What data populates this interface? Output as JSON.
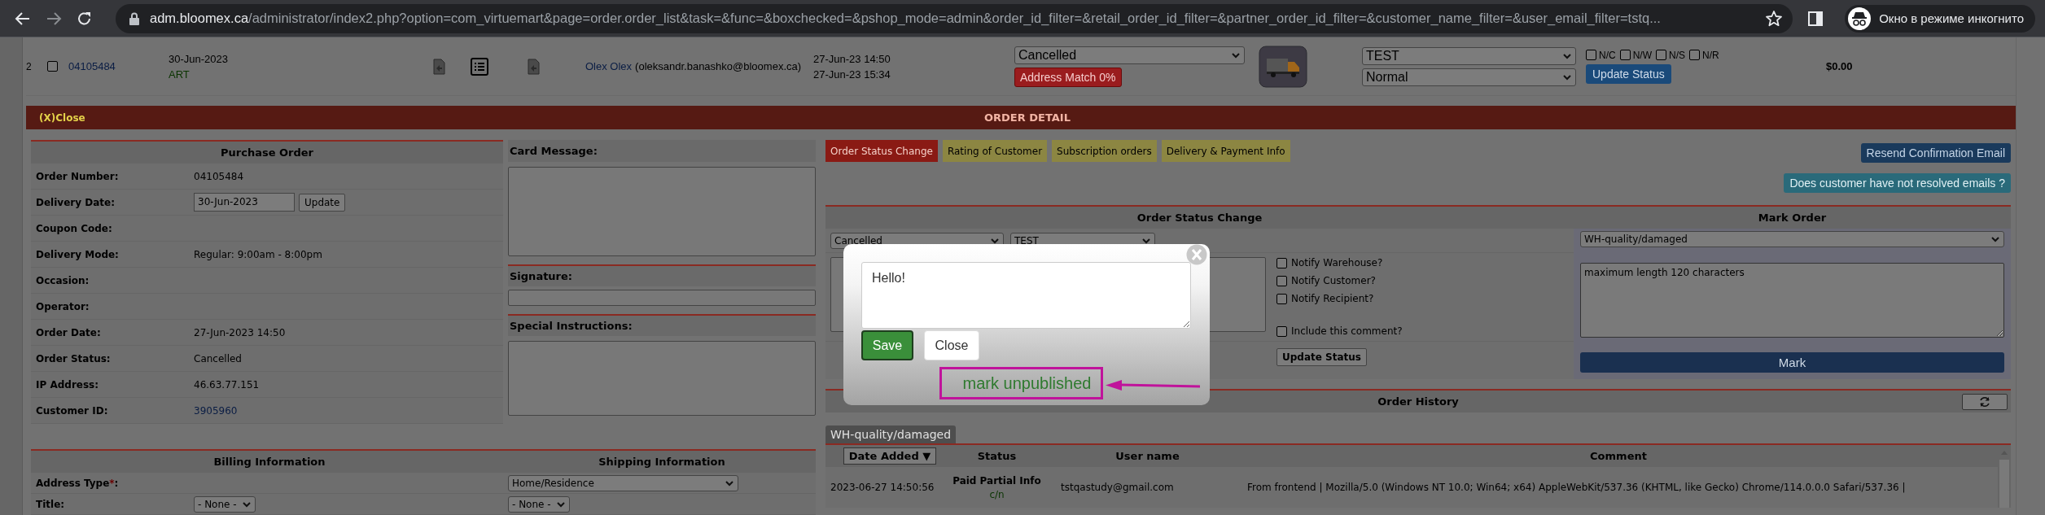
{
  "browser": {
    "host": "adm.bloomex.ca",
    "path": "/administrator/index2.php?option=com_virtuemart&page=order.order_list&task=&func=&boxchecked=&pshop_mode=admin&order_id_filter=&retail_order_id_filter=&partner_order_id_filter=&customer_name_filter=&user_email_filter=tstq...",
    "incognito_label": "Окно в режиме инкогнито"
  },
  "order_row": {
    "index": "2",
    "checked": false,
    "order_number": "04105484",
    "date": "30-Jun-2023",
    "source": "ART",
    "customer_name": "Olex Olex",
    "customer_email": "(oleksandr.banashko@bloomex.ca)",
    "created": "27-Jun-23 14:50",
    "modified": "27-Jun-23 15:34",
    "status": "Cancelled",
    "address_match": "Address Match 0%",
    "select_1": "TEST",
    "select_2": "Normal",
    "flags": [
      {
        "label": "N/C",
        "checked": false
      },
      {
        "label": "N/W",
        "checked": false
      },
      {
        "label": "N/S",
        "checked": false
      },
      {
        "label": "N/R",
        "checked": false
      }
    ],
    "update_button": "Update Status",
    "total": "$0.00"
  },
  "detail_bar": {
    "close": "(X)Close",
    "title": "ORDER DETAIL"
  },
  "purchase_order": {
    "title": "Purchase Order",
    "fields": [
      {
        "label": "Order Number:",
        "kind": "text",
        "value": "04105484"
      },
      {
        "label": "Delivery Date:",
        "kind": "date",
        "value": "30-Jun-2023",
        "button": "Update"
      },
      {
        "label": "Coupon Code:",
        "kind": "empty"
      },
      {
        "label": "Delivery Mode:",
        "kind": "text",
        "value": "Regular: 9:00am - 8:00pm"
      },
      {
        "label": "Occasion:",
        "kind": "empty"
      },
      {
        "label": "Operator:",
        "kind": "empty"
      },
      {
        "label": "Order Date:",
        "kind": "text",
        "value": "27-Jun-2023 14:50"
      },
      {
        "label": "Order Status:",
        "kind": "text",
        "value": "Cancelled"
      },
      {
        "label": "IP Address:",
        "kind": "text",
        "value": "46.63.77.151"
      },
      {
        "label": "Customer ID:",
        "kind": "link",
        "value": "3905960"
      }
    ]
  },
  "card_message": {
    "title": "Card Message:"
  },
  "signature": {
    "title": "Signature:"
  },
  "special_instructions": {
    "title": "Special Instructions:"
  },
  "billing": {
    "title": "Billing Information",
    "fields": [
      {
        "label": "Address Type",
        "required_mark": "*",
        "label_end": ":"
      },
      {
        "label": "Title:",
        "value": "- None -"
      }
    ]
  },
  "shipping": {
    "title": "Shipping Information",
    "fields": [
      {
        "value": "Home/Residence",
        "kind": "wide"
      },
      {
        "value": "- None -",
        "kind": "small"
      }
    ]
  },
  "tabs": [
    {
      "label": "Order Status Change",
      "selected": true
    },
    {
      "label": "Rating of Customer",
      "selected": false
    },
    {
      "label": "Subscription orders",
      "selected": false
    },
    {
      "label": "Delivery & Payment Info",
      "selected": false
    }
  ],
  "resend_button": "Resend Confirmation Email",
  "unresolved_button": "Does customer have not resolved emails ?",
  "status_change": {
    "title": "Order Status Change",
    "status": "Cancelled",
    "reason": "TEST",
    "notify": [
      {
        "label": "Notify Warehouse?",
        "checked": false
      },
      {
        "label": "Notify Customer?",
        "checked": false
      },
      {
        "label": "Notify Recipient?",
        "checked": false
      }
    ],
    "include": {
      "label": "Include this comment?",
      "checked": false
    },
    "update_button": "Update Status"
  },
  "mark_order": {
    "title": "Mark Order",
    "reason": "WH-quality/damaged",
    "placeholder": "maximum length 120 characters",
    "button": "Mark"
  },
  "order_history": {
    "title": "Order History",
    "tag": "WH-quality/damaged",
    "columns": [
      {
        "label": "Date Added ▼",
        "kind": "sort"
      },
      {
        "label": "Status",
        "kind": "plain"
      },
      {
        "label": "User name",
        "kind": "plain"
      },
      {
        "label": "Comment",
        "kind": "plain"
      }
    ],
    "rows": [
      {
        "date": "2023-06-27 14:50:56",
        "status": "Paid Partial Info",
        "status_note": "c/n",
        "user": "tstqastudy@gmail.com",
        "comment": "From frontend | Mozilla/5.0 (Windows NT 10.0; Win64; x64) AppleWebKit/537.36 (KHTML, like Gecko) Chrome/114.0.0.0 Safari/537.36 |"
      }
    ]
  },
  "modal": {
    "text": "Hello!",
    "save": "Save",
    "close": "Close",
    "note": "mark unpublished"
  }
}
